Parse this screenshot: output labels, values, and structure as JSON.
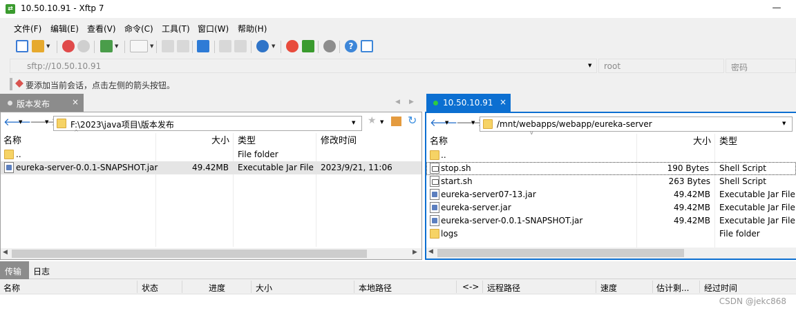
{
  "window": {
    "title": "10.50.10.91 - Xftp 7",
    "app_icon": "xftp-icon"
  },
  "menu": [
    "文件(F)",
    "编辑(E)",
    "查看(V)",
    "命令(C)",
    "工具(T)",
    "窗口(W)",
    "帮助(H)"
  ],
  "address": {
    "value": "sftp://10.50.10.91",
    "user_placeholder": "root",
    "password_placeholder": "密码"
  },
  "hint": "要添加当前会话，点击左侧的箭头按钮。",
  "left": {
    "tab": "版本发布",
    "path": "F:\\2023\\java项目\\版本发布",
    "headers": {
      "name": "名称",
      "size": "大小",
      "type": "类型",
      "modified": "修改时间"
    },
    "files": [
      {
        "name": "..",
        "size": "",
        "type": "File folder",
        "modified": "",
        "icon": "folder-icon"
      },
      {
        "name": "eureka-server-0.0.1-SNAPSHOT.jar",
        "size": "49.42MB",
        "type": "Executable Jar File",
        "modified": "2023/9/21, 11:06",
        "icon": "jar-file-icon"
      }
    ]
  },
  "right": {
    "tab": "10.50.10.91",
    "path": "/mnt/webapps/webapp/eureka-server",
    "headers": {
      "name": "名称",
      "size": "大小",
      "type": "类型"
    },
    "files": [
      {
        "name": "..",
        "size": "",
        "type": "",
        "icon": "folder-icon"
      },
      {
        "name": "stop.sh",
        "size": "190 Bytes",
        "type": "Shell Script",
        "icon": "shell-script-icon"
      },
      {
        "name": "start.sh",
        "size": "263 Bytes",
        "type": "Shell Script",
        "icon": "shell-script-icon"
      },
      {
        "name": "eureka-server07-13.jar",
        "size": "49.42MB",
        "type": "Executable Jar File",
        "icon": "jar-file-icon"
      },
      {
        "name": "eureka-server.jar",
        "size": "49.42MB",
        "type": "Executable Jar File",
        "icon": "jar-file-icon"
      },
      {
        "name": "eureka-server-0.0.1-SNAPSHOT.jar",
        "size": "49.42MB",
        "type": "Executable Jar File",
        "icon": "jar-file-icon"
      },
      {
        "name": "logs",
        "size": "",
        "type": "File folder",
        "icon": "folder-icon"
      }
    ]
  },
  "bottom": {
    "tabs": [
      "传输",
      "日志"
    ],
    "headers": [
      "名称",
      "状态",
      "进度",
      "大小",
      "本地路径",
      "<->",
      "远程路径",
      "速度",
      "估计剩...",
      "经过时间"
    ]
  },
  "watermark": "CSDN @jekc868",
  "colors": {
    "accent": "#0c6fd1",
    "connected": "#2ecc40",
    "selection": "#e5e5e5"
  }
}
